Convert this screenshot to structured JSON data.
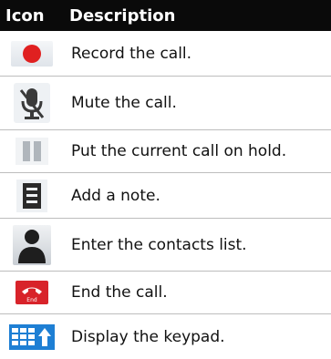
{
  "header": {
    "icon_label": "Icon",
    "description_label": "Description"
  },
  "rows": [
    {
      "icon": "record-icon",
      "description": "Record the call."
    },
    {
      "icon": "mute-microphone-icon",
      "description": "Mute the call."
    },
    {
      "icon": "pause-icon",
      "description": "Put the current call on hold."
    },
    {
      "icon": "note-icon",
      "description": "Add a note."
    },
    {
      "icon": "contact-person-icon",
      "description": "Enter the contacts list."
    },
    {
      "icon": "end-call-icon",
      "icon_text": "End",
      "description": "End the call."
    },
    {
      "icon": "keypad-icon",
      "description": "Display the keypad."
    }
  ],
  "colors": {
    "header_bg": "#0a0a0a",
    "record_red": "#e02020",
    "end_call_red": "#d8232a",
    "keypad_blue": "#1e7fd4"
  }
}
